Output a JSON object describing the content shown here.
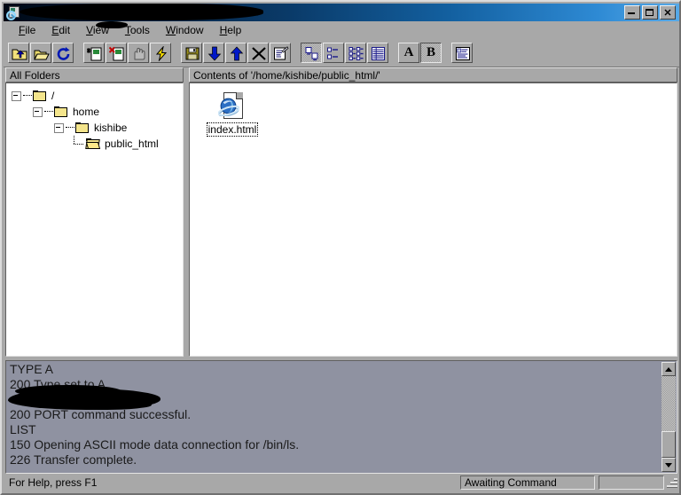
{
  "window": {
    "title": "",
    "title_redacted": true,
    "icon": "ftp-server-search-icon",
    "buttons": [
      {
        "name": "minimize-button",
        "glyph": "_"
      },
      {
        "name": "maximize-button",
        "glyph": "□"
      },
      {
        "name": "close-button",
        "glyph": "✕"
      }
    ]
  },
  "menubar": {
    "items": [
      {
        "name": "menu-file",
        "label": "File",
        "accel": "F"
      },
      {
        "name": "menu-edit",
        "label": "Edit",
        "accel": "E"
      },
      {
        "name": "menu-view",
        "label": "View",
        "accel": "V"
      },
      {
        "name": "menu-tools",
        "label": "Tools",
        "accel": "T"
      },
      {
        "name": "menu-window",
        "label": "Window",
        "accel": "W"
      },
      {
        "name": "menu-help",
        "label": "Help",
        "accel": "H"
      }
    ]
  },
  "toolbar": {
    "groups": [
      {
        "name": "navigation-group",
        "buttons": [
          {
            "name": "up-one-level-button",
            "icon": "folder-up-icon",
            "pressed": false
          },
          {
            "name": "open-folder-button",
            "icon": "open-folder-icon",
            "pressed": false
          },
          {
            "name": "refresh-button",
            "icon": "refresh-icon",
            "pressed": false
          }
        ]
      },
      {
        "name": "file-actions-group",
        "buttons": [
          {
            "name": "new-file-button",
            "icon": "new-file-icon",
            "pressed": false
          },
          {
            "name": "delete-file-button",
            "icon": "delete-file-icon",
            "pressed": false
          },
          {
            "name": "permissions-button",
            "icon": "hand-icon",
            "pressed": false
          },
          {
            "name": "execute-button",
            "icon": "lightning-icon",
            "pressed": false
          }
        ]
      },
      {
        "name": "transfer-group",
        "buttons": [
          {
            "name": "save-button",
            "icon": "floppy-disk-icon",
            "pressed": false
          },
          {
            "name": "download-button",
            "icon": "arrow-down-icon",
            "pressed": false
          },
          {
            "name": "upload-button",
            "icon": "arrow-up-icon",
            "pressed": false
          },
          {
            "name": "abort-button",
            "icon": "cancel-x-icon",
            "pressed": false
          },
          {
            "name": "edit-properties-button",
            "icon": "document-edit-icon",
            "pressed": false
          }
        ]
      },
      {
        "name": "view-mode-group",
        "buttons": [
          {
            "name": "view-large-icons-button",
            "icon": "large-icons-icon",
            "pressed": true
          },
          {
            "name": "view-small-icons-button",
            "icon": "small-icons-icon",
            "pressed": false
          },
          {
            "name": "view-list-button",
            "icon": "list-view-icon",
            "pressed": false
          },
          {
            "name": "view-details-button",
            "icon": "details-view-icon",
            "pressed": false
          }
        ]
      },
      {
        "name": "transfer-mode-group",
        "buttons": [
          {
            "name": "ascii-mode-button",
            "icon": "letter-a-icon",
            "label": "A",
            "pressed": false
          },
          {
            "name": "binary-mode-button",
            "icon": "letter-b-icon",
            "label": "B",
            "pressed": true
          }
        ]
      },
      {
        "name": "log-group",
        "buttons": [
          {
            "name": "show-log-button",
            "icon": "log-window-icon",
            "pressed": false
          }
        ]
      }
    ]
  },
  "panes": {
    "left_header": "All Folders",
    "right_header": "Contents of '/home/kishibe/public_html/'"
  },
  "tree": {
    "nodes": [
      {
        "name": "tree-node-root",
        "label": "/",
        "depth": 0,
        "expanded": true,
        "selected": false
      },
      {
        "name": "tree-node-home",
        "label": "home",
        "depth": 1,
        "expanded": true,
        "selected": false
      },
      {
        "name": "tree-node-kishibe",
        "label": "kishibe",
        "depth": 2,
        "expanded": true,
        "selected": false
      },
      {
        "name": "tree-node-public-html",
        "label": "public_html",
        "depth": 3,
        "expanded": false,
        "selected": true
      }
    ]
  },
  "files": {
    "items": [
      {
        "name": "file-item-index-html",
        "label": "index.html",
        "icon": "internet-explorer-document-icon",
        "selected": true
      }
    ]
  },
  "log": {
    "lines": [
      "TYPE A",
      "200 Type set to A.",
      "",
      "200 PORT command successful.",
      "LIST",
      "150 Opening ASCII mode data connection for /bin/ls.",
      "226 Transfer complete."
    ],
    "redacted_line_index": 2
  },
  "statusbar": {
    "help_text": "For Help, press F1",
    "state_text": "Awaiting Command",
    "extra_text": ""
  }
}
